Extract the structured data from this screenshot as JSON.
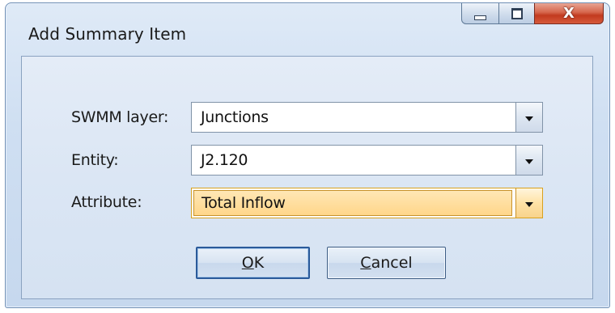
{
  "window": {
    "title": "Add Summary Item",
    "minimize_icon": "minimize-icon",
    "maximize_icon": "maximize-icon",
    "close_glyph": "X",
    "close_icon": "close-icon"
  },
  "form": {
    "swmm_layer": {
      "label": "SWMM layer:",
      "value": "Junctions",
      "arrow_icon": "dropdown-arrow-icon"
    },
    "entity": {
      "label": "Entity:",
      "value": "J2.120",
      "arrow_icon": "dropdown-arrow-icon"
    },
    "attribute": {
      "label": "Attribute:",
      "value": "Total Inflow",
      "arrow_icon": "dropdown-arrow-icon",
      "state": "focused/highlighted"
    }
  },
  "buttons": {
    "ok": {
      "accel": "O",
      "rest": "K"
    },
    "cancel": {
      "accel": "C",
      "rest": "ancel"
    }
  },
  "colors": {
    "window_bg": "#cfdff2",
    "client_bg": "#dbe6f4",
    "highlight": "#ffd68a",
    "close_button": "#c23a1f"
  }
}
